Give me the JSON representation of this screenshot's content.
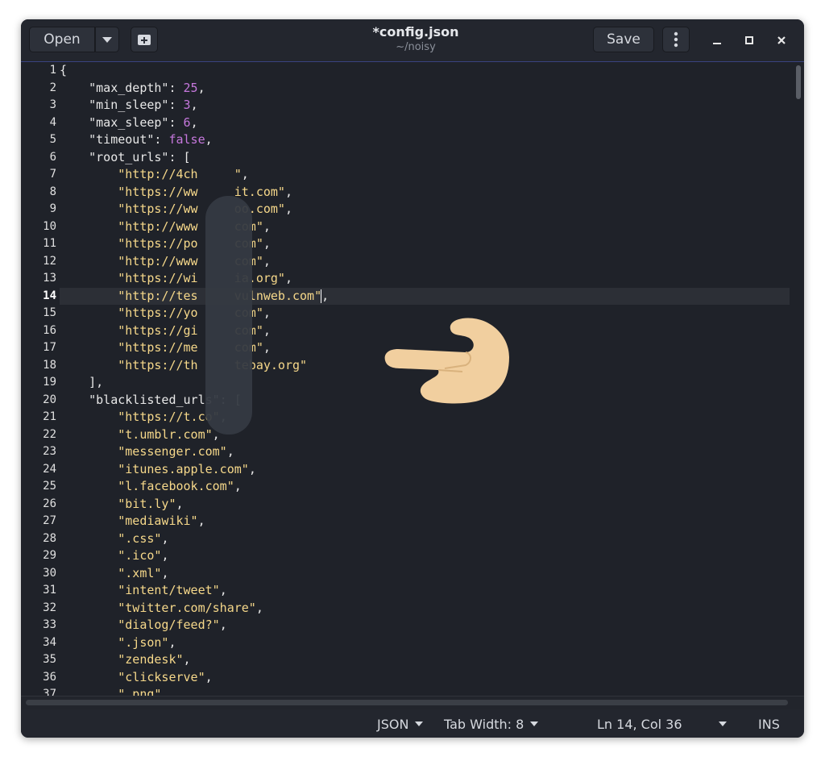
{
  "header": {
    "open_label": "Open",
    "title": "*config.json",
    "subtitle": "~/noisy",
    "save_label": "Save"
  },
  "editor": {
    "current_line": 14,
    "lines": [
      "{",
      "    \"max_depth\": 25,",
      "    \"min_sleep\": 3,",
      "    \"max_sleep\": 6,",
      "    \"timeout\": false,",
      "    \"root_urls\": [",
      "        \"http://4ch     \",",
      "        \"https://ww     it.com\",",
      "        \"https://ww     oo.com\",",
      "        \"http://www     com\",",
      "        \"https://po     com\",",
      "        \"http://www     com\",",
      "        \"https://wi     ia.org\",",
      "        \"http://tes     vulnweb.com\",",
      "        \"https://yo     com\",",
      "        \"https://gi     com\",",
      "        \"https://me     com\",",
      "        \"https://th     tebay.org\"",
      "    ],",
      "    \"blacklisted_urls\": [",
      "        \"https://t.co\",",
      "        \"t.umblr.com\",",
      "        \"messenger.com\",",
      "        \"itunes.apple.com\",",
      "        \"l.facebook.com\",",
      "        \"bit.ly\",",
      "        \"mediawiki\",",
      "        \".css\",",
      "        \".ico\",",
      "        \".xml\",",
      "        \"intent/tweet\",",
      "        \"twitter.com/share\",",
      "        \"dialog/feed?\",",
      "        \".json\",",
      "        \"zendesk\",",
      "        \"clickserve\",",
      "        \".png\","
    ]
  },
  "statusbar": {
    "language": "JSON",
    "tab_width": "Tab Width: 8",
    "position": "Ln 14, Col 36",
    "mode": "INS"
  },
  "icons": {
    "dropdown": "chevron-down-icon",
    "new_tab": "new-tab-icon",
    "menu": "kebab-menu-icon",
    "minimize": "minimize-icon",
    "maximize": "maximize-icon",
    "close": "close-icon",
    "pointer": "pointing-hand-icon"
  },
  "colors": {
    "background": "#1f2229",
    "string": "#f6d88a",
    "number": "#c678dd",
    "accent_border": "#3a4380"
  }
}
